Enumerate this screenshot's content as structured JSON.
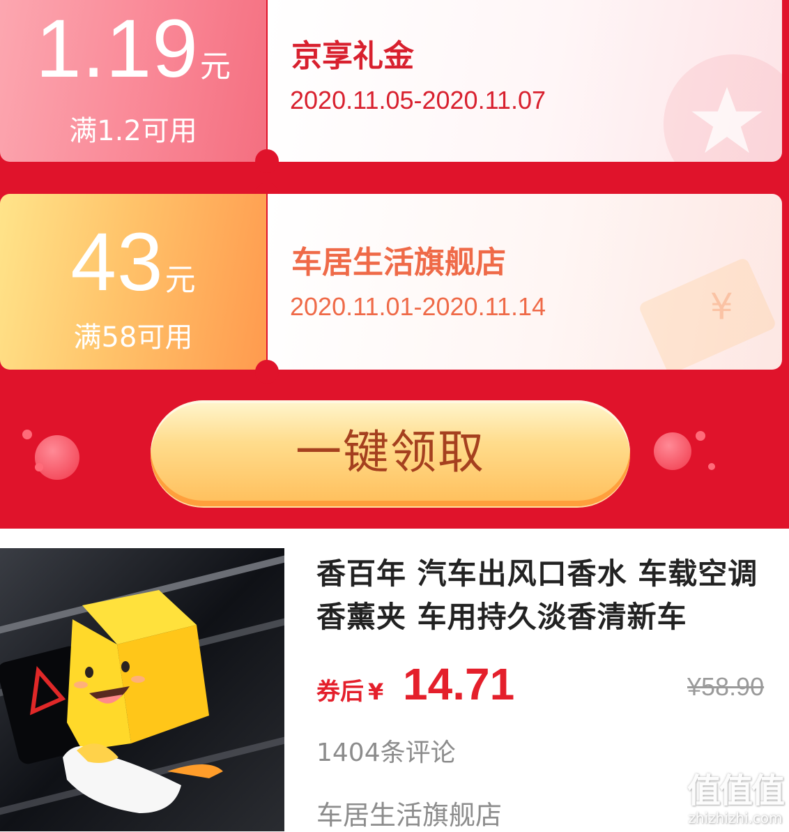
{
  "coupons": [
    {
      "amount": "1.19",
      "unit": "元",
      "condition": "满1.2可用",
      "title": "京享礼金",
      "validity": "2020.11.05-2020.11.07"
    },
    {
      "amount": "43",
      "unit": "元",
      "condition": "满58可用",
      "title": "车居生活旗舰店",
      "validity": "2020.11.01-2020.11.14"
    }
  ],
  "claim_button": "一键领取",
  "product": {
    "title": "香百年 汽车出风口香水 车载空调香薰夹 车用持久淡香清新车",
    "price_label": "券后",
    "currency": "¥",
    "price": "14.71",
    "original_price": "¥58.90",
    "reviews": "1404条评论",
    "shop": "车居生活旗舰店"
  },
  "watermark": {
    "logo": "值值值",
    "site": "zhizhizhi.com"
  },
  "colors": {
    "background_red": "#e0132b",
    "price_red": "#e41f2b",
    "button_text": "#a5401f"
  },
  "icons": [
    "star-icon",
    "yen-ticket-icon"
  ]
}
